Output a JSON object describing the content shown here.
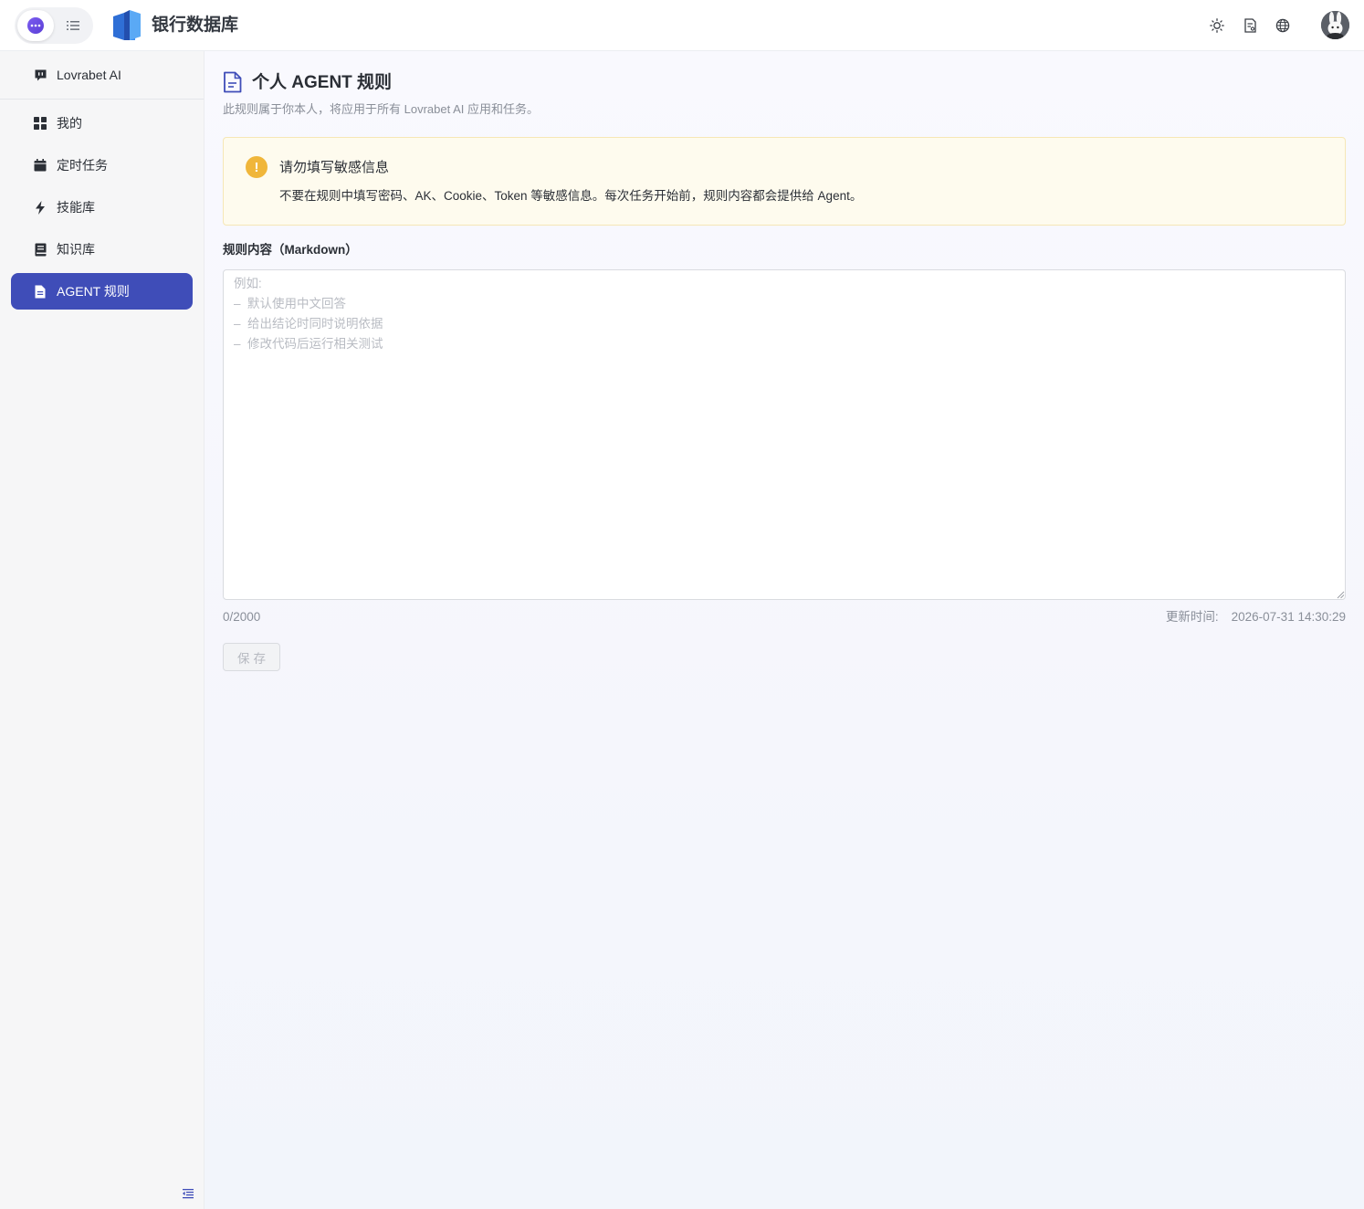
{
  "header": {
    "app_title": "银行数据库",
    "icons": [
      "chat-mode-icon",
      "list-mode-icon",
      "logo-icon",
      "sun-icon",
      "document-icon",
      "globe-icon",
      "avatar"
    ]
  },
  "sidebar": {
    "top_item": {
      "label": "Lovrabet AI",
      "icon": "chat-bubble-icon"
    },
    "items": [
      {
        "label": "我的",
        "icon": "grid-icon",
        "active": false
      },
      {
        "label": "定时任务",
        "icon": "calendar-icon",
        "active": false
      },
      {
        "label": "技能库",
        "icon": "lightning-icon",
        "active": false
      },
      {
        "label": "知识库",
        "icon": "book-icon",
        "active": false
      },
      {
        "label": "AGENT 规则",
        "icon": "document-icon",
        "active": true
      }
    ]
  },
  "main": {
    "title": "个人 AGENT 规则",
    "subtitle": "此规则属于你本人，将应用于所有 Lovrabet AI 应用和任务。",
    "warning": {
      "title": "请勿填写敏感信息",
      "text": "不要在规则中填写密码、AK、Cookie、Token 等敏感信息。每次任务开始前，规则内容都会提供给 Agent。"
    },
    "field_label": "规则内容（Markdown）",
    "textarea": {
      "value": "",
      "placeholder": "例如:\n–  默认使用中文回答\n–  给出结论时同时说明依据\n–  修改代码后运行相关测试"
    },
    "char_count": "0/2000",
    "updated_label": "更新时间:",
    "updated_value": "2026-07-31 14:30:29",
    "save_label": "保存"
  },
  "colors": {
    "accent": "#3f4db8",
    "warning": "#f0b63a",
    "warning_bg": "#fefbee"
  }
}
